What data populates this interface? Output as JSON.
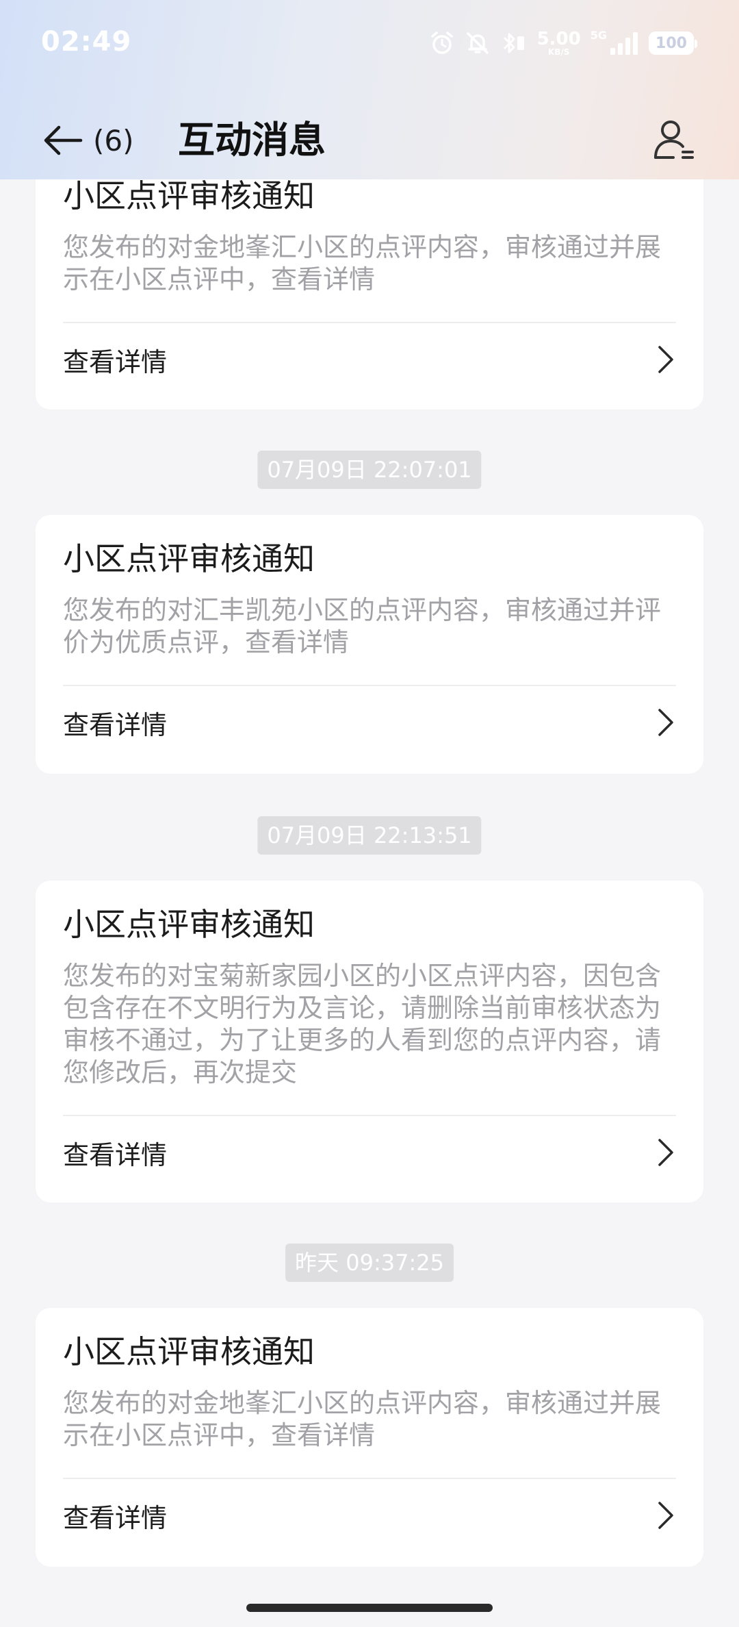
{
  "status_bar": {
    "time": "02:49",
    "net_speed_value": "5.00",
    "net_speed_unit": "KB/S",
    "signal_label": "5G",
    "battery": "100"
  },
  "nav": {
    "back_count": "(6)",
    "title": "互动消息"
  },
  "timestamps": [
    "07月09日 22:07:01",
    "07月09日 22:13:51",
    "昨天 09:37:25"
  ],
  "cards": [
    {
      "title": "小区点评审核通知",
      "desc": "您发布的对金地峯汇小区的点评内容，审核通过并展示在小区点评中，查看详情",
      "link": "查看详情"
    },
    {
      "title": "小区点评审核通知",
      "desc": "您发布的对汇丰凯苑小区的点评内容，审核通过并评价为优质点评，查看详情",
      "link": "查看详情"
    },
    {
      "title": "小区点评审核通知",
      "desc": "您发布的对宝菊新家园小区的小区点评内容，因包含包含存在不文明行为及言论，请删除当前审核状态为审核不通过，为了让更多的人看到您的点评内容，请您修改后，再次提交",
      "link": "查看详情"
    },
    {
      "title": "小区点评审核通知",
      "desc": "您发布的对金地峯汇小区的点评内容，审核通过并展示在小区点评中，查看详情",
      "link": "查看详情"
    }
  ],
  "colors": {
    "page_bg": "#f5f5f7",
    "card_bg": "#ffffff",
    "title_text": "#1c1c1c",
    "desc_text": "#a2a2a6",
    "timestamp_bg": "#dedee0"
  }
}
